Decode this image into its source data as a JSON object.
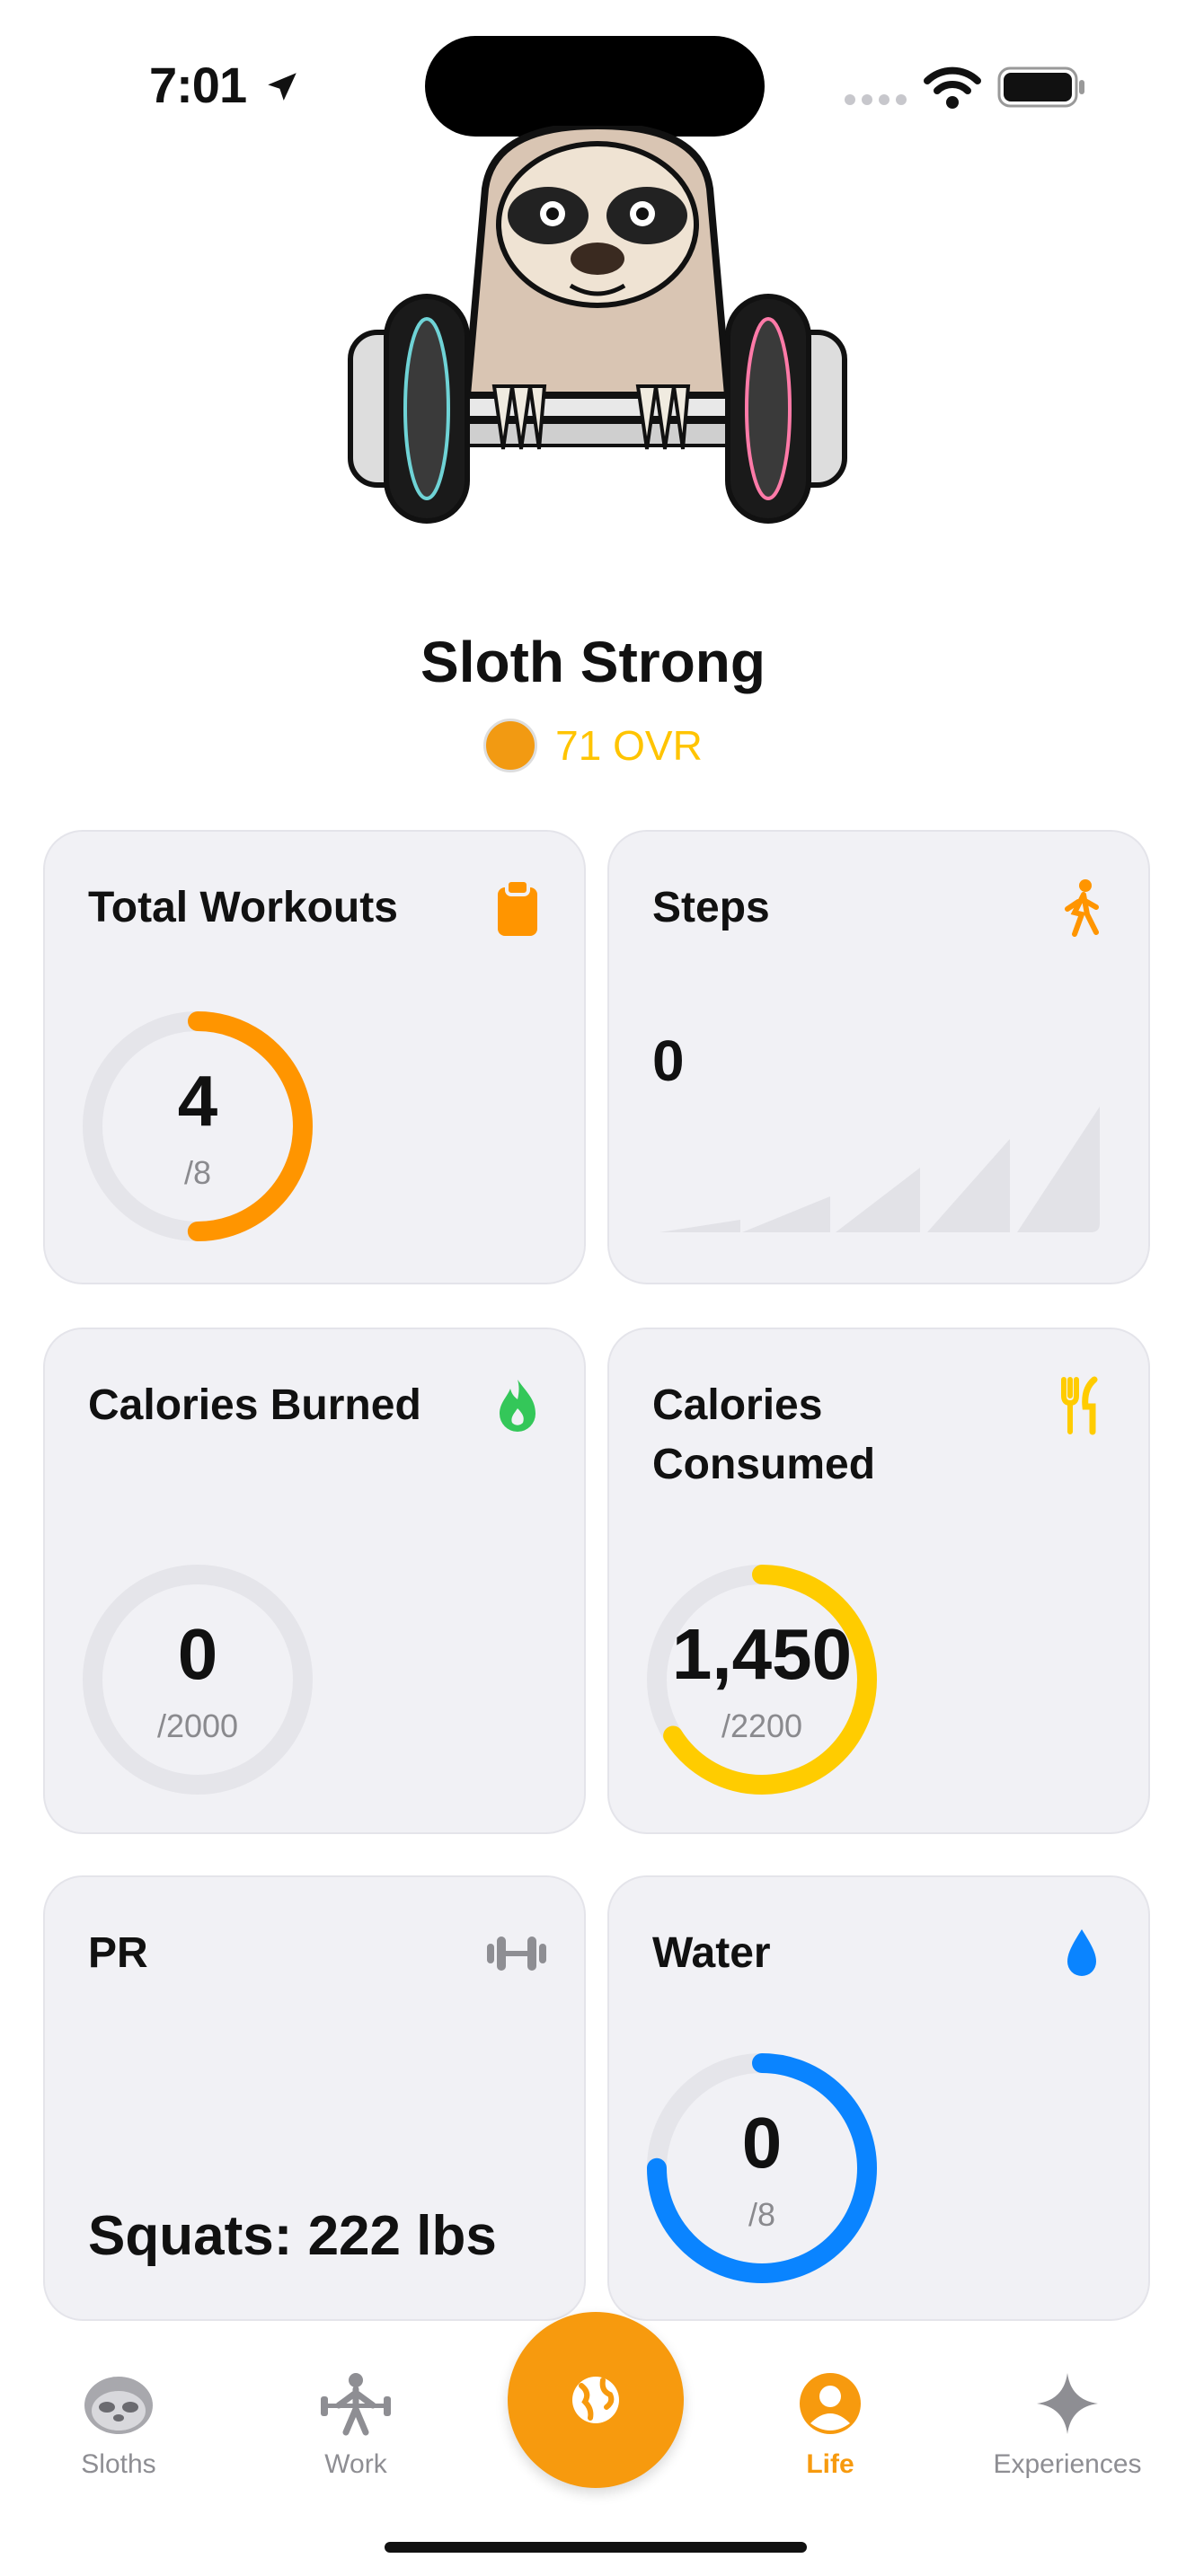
{
  "status_bar": {
    "time": "7:01"
  },
  "hero": {
    "title": "Sloth Strong",
    "ovr": "71 OVR"
  },
  "cards": {
    "total_workouts": {
      "title": "Total Workouts",
      "value": "4",
      "goal": "/8",
      "progress": 0.5,
      "icon": "clipboard-icon",
      "color": "#FF9500"
    },
    "steps": {
      "title": "Steps",
      "value": "0",
      "icon": "walking-icon",
      "color": "#FF9500"
    },
    "calories_burned": {
      "title": "Calories Burned",
      "value": "0",
      "goal": "/2000",
      "progress": 0,
      "icon": "flame-icon",
      "color": "#34C759"
    },
    "calories_consumed": {
      "title": "Calories Consumed",
      "title_line1": "Calories",
      "title_line2": "Consumed",
      "value": "1,450",
      "goal": "/2200",
      "progress": 0.66,
      "icon": "fork-knife-icon",
      "color": "#FFCC00"
    },
    "pr": {
      "title": "PR",
      "value": "Squats: 222 lbs",
      "icon": "dumbbell-icon"
    },
    "water": {
      "title": "Water",
      "value": "0",
      "goal": "/8",
      "progress": 0.75,
      "icon": "water-drop-icon",
      "color": "#0A84FF"
    }
  },
  "tabs": [
    {
      "label": "Sloths",
      "icon": "sloth-icon",
      "active": false
    },
    {
      "label": "Work",
      "icon": "weightlifter-icon",
      "active": false
    },
    {
      "label": "Life",
      "icon": "person-circle-icon",
      "active": true
    },
    {
      "label": "Experiences",
      "icon": "sparkle-icon",
      "active": false
    }
  ],
  "center_button": {
    "icon": "globe-icon",
    "color": "#FF9500"
  }
}
